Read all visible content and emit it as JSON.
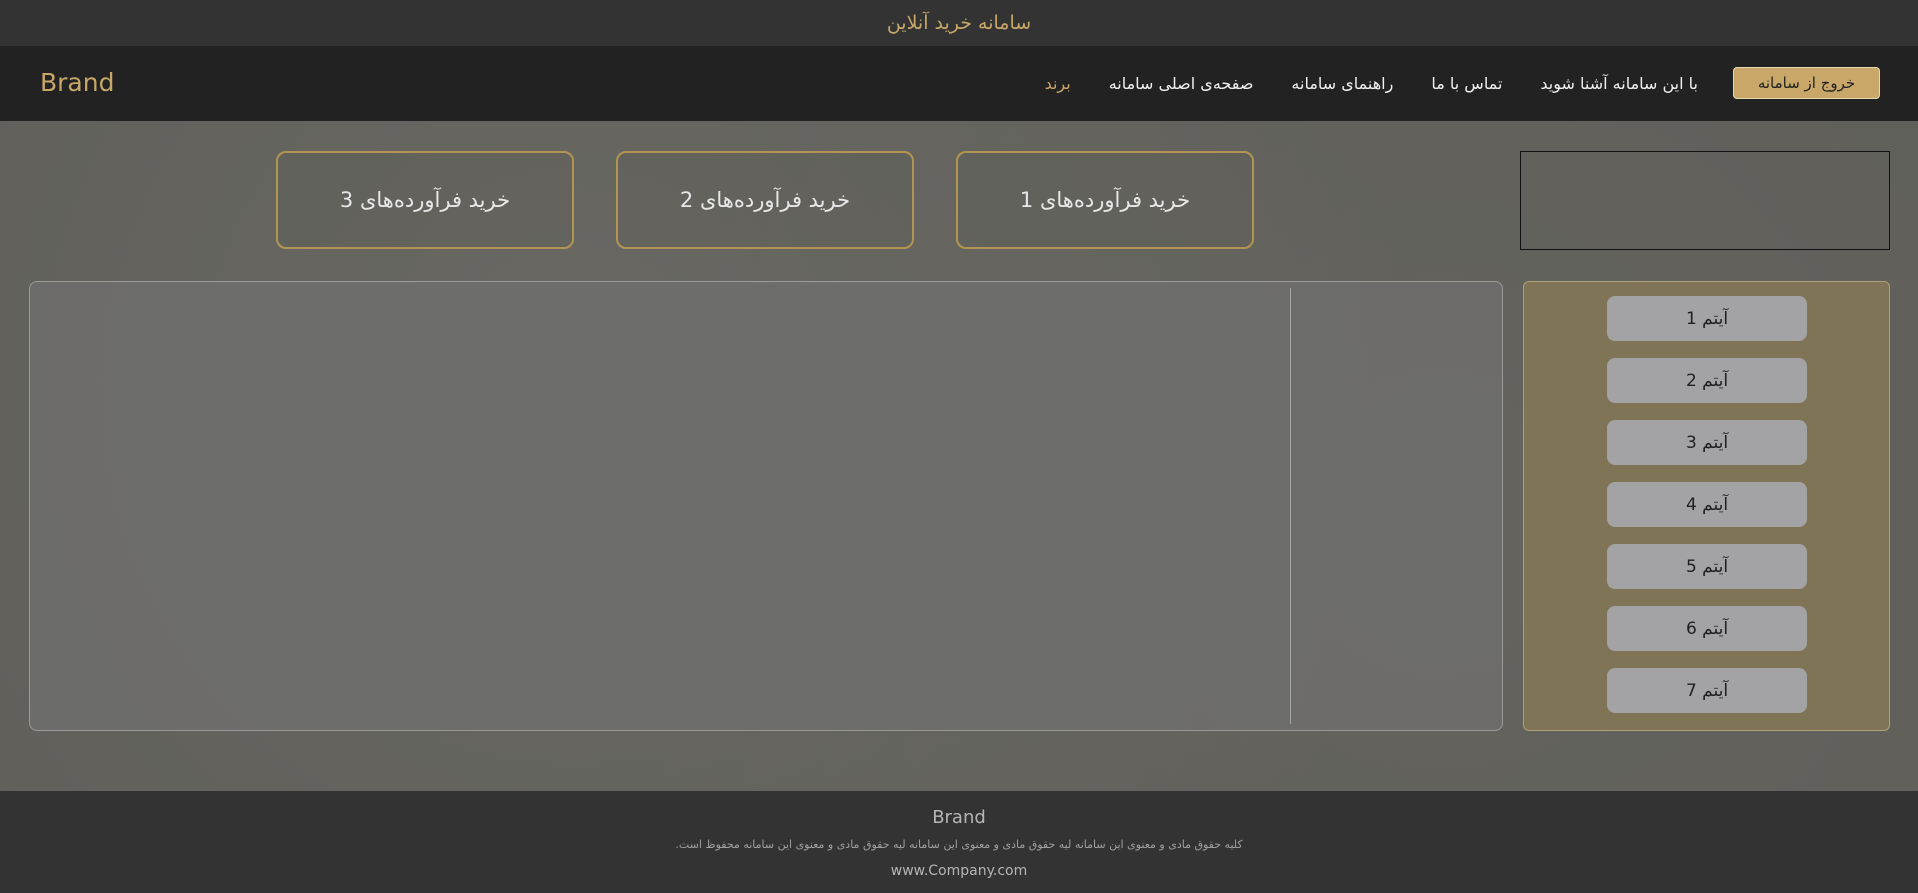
{
  "topbar": {
    "title": "سامانه خرید آنلاین"
  },
  "navbar": {
    "brand": "Brand",
    "logout_label": "خروج از سامانه",
    "links": [
      {
        "label": "برند",
        "active": true
      },
      {
        "label": "صفحه‌ی اصلی سامانه"
      },
      {
        "label": "راهنمای سامانه"
      },
      {
        "label": "تماس با ما"
      },
      {
        "label": "با این سامانه آشنا شوید"
      }
    ],
    "accent_color": "#c8a768"
  },
  "buy_buttons": [
    {
      "label": "خرید فرآورده‌های 1"
    },
    {
      "label": "خرید فرآورده‌های 2"
    },
    {
      "label": "خرید فرآورده‌های 3"
    }
  ],
  "sidebar": {
    "items": [
      {
        "label": "آیتم 1"
      },
      {
        "label": "آیتم 2"
      },
      {
        "label": "آیتم 3"
      },
      {
        "label": "آیتم 4"
      },
      {
        "label": "آیتم 5"
      },
      {
        "label": "آیتم 6"
      },
      {
        "label": "آیتم 7"
      }
    ]
  },
  "footer": {
    "brand": "Brand",
    "rights": "کلیه حقوق مادی و معنوی این سامانه لیه حقوق مادی و معنوی این سامانه لیه حقوق مادی و معنوی این سامانه محفوظ است.",
    "website": "www.Company.com"
  }
}
